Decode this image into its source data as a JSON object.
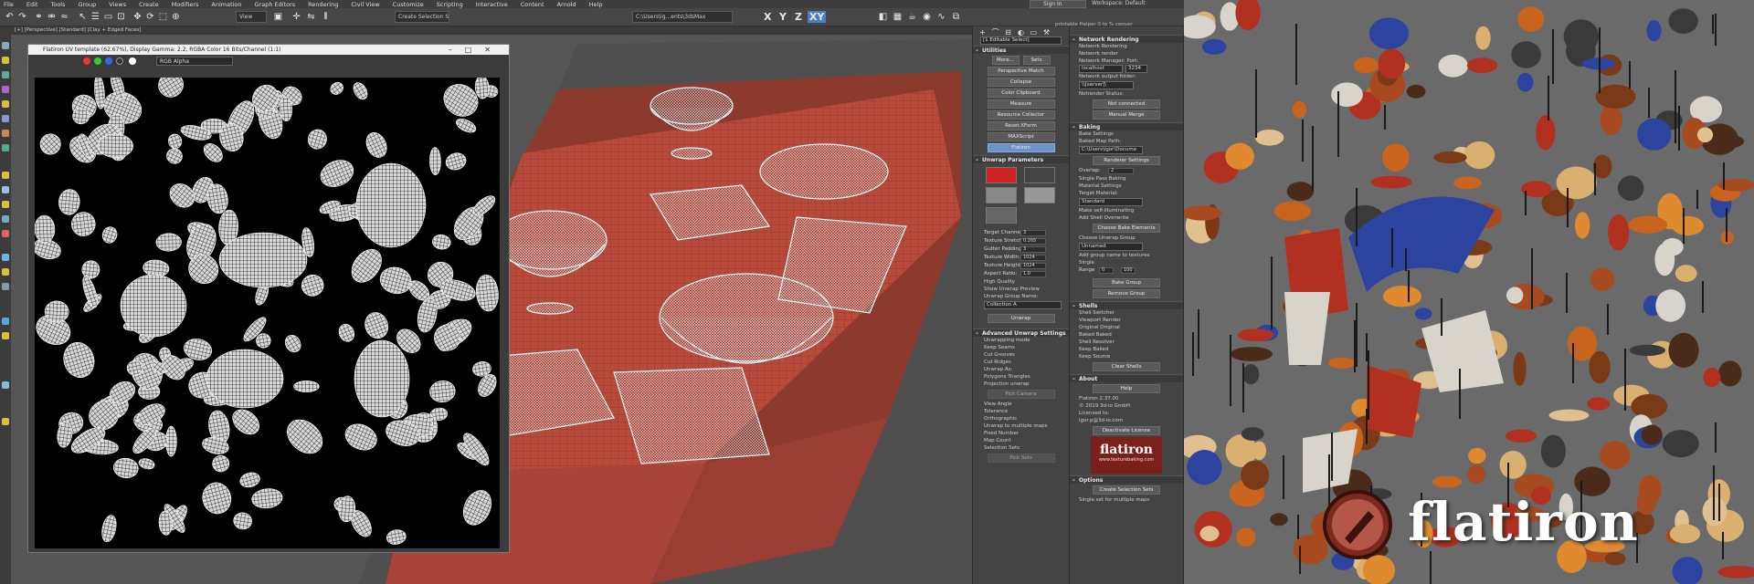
{
  "menu": [
    "File",
    "Edit",
    "Tools",
    "Group",
    "Views",
    "Create",
    "Modifiers",
    "Animation",
    "Graph Editors",
    "Rendering",
    "Civil View",
    "Customize",
    "Scripting",
    "Interactive",
    "Content",
    "Arnold",
    "Help"
  ],
  "signin": "Sign In",
  "workspace": "Workspace: Default",
  "toolbar": {
    "view_combo": "View",
    "selection_set": "Create Selection Se",
    "path_combo": "C:\\Users\\ig...ents\\3dsMax",
    "axes": [
      "X",
      "Y",
      "Z",
      "XY"
    ],
    "selected_axis": "XY",
    "hint": "printable Helper 0 to % conver"
  },
  "viewport_label": "[+] [Perspective] [Standard] [Clay + Edged Faces]",
  "uv_window": {
    "title": "Flatiron UV template (62.67%), Display Gamma: 2.2, RGBA Color 16 Bits/Channel (1:1)",
    "channel": "RGB Alpha"
  },
  "cmd_panel": {
    "selection": "[1 Editable Select]",
    "utilities_title": "Utilities",
    "utilities_top": [
      "More...",
      "Sets"
    ],
    "utilities_buttons": [
      "Perspective Match",
      "Collapse",
      "Color Clipboard",
      "Measure",
      "Resource Collector",
      "Reset XForm",
      "MAXScript",
      "Flatiron"
    ],
    "active_utility": "Flatiron",
    "unwrap_title": "Unwrap Parameters",
    "params": [
      {
        "label": "Target Channel:",
        "value": "3"
      },
      {
        "label": "Texture Stretch:",
        "value": "0.265"
      },
      {
        "label": "Gutter Padding:",
        "value": "3"
      },
      {
        "label": "Texture Width:",
        "value": "1024"
      },
      {
        "label": "Texture Height:",
        "value": "1024"
      },
      {
        "label": "Aspect Ratio:",
        "value": "1.0"
      }
    ],
    "checks": [
      "High Quality",
      "Show Unwrap Preview"
    ],
    "group_name_label": "Unwrap Group Name:",
    "group_name_value": "Collection A",
    "unwrap_btn": "Unwrap",
    "adv_title": "Advanced Unwrap Settings",
    "adv_lines": [
      "Unwrapping mode",
      "Keep Seams",
      "Cut Grooves",
      "Cut Ridges",
      "Unwrap As:",
      "Polygons  Triangles",
      "Projection unwrap",
      "Pick Camera",
      "View Angle",
      "Tolerance",
      "Orthographic",
      "Unwrap to multiple maps",
      "Fixed Number",
      "Map Count",
      "Selection Sets",
      "Pick Sets"
    ]
  },
  "right_panel": {
    "net_title": "Network Rendering",
    "net_lines": [
      "Network Rendering",
      "Network render",
      "Network Manager:  Port:"
    ],
    "host": "localhost",
    "port": "3234",
    "output_label": "Network output folder:",
    "output_value": "\\\\[server]\\",
    "status_label": "Netrender Status:",
    "status": "Not connected",
    "merge_btn": "Manual Merge",
    "baking_title": "Baking",
    "bake_settings": "Bake Settings",
    "map_path_label": "Baked Map Path:",
    "map_path": "C:\\Users\\igor\\Docume",
    "renderer_btn": "Renderer Settings",
    "overlap_label": "Overlap:",
    "overlap": "2",
    "single_pass": "Single Pass Baking",
    "mat_settings": "Material Settings",
    "target_mat_label": "Target Material:",
    "target_mat": "Standard",
    "self_illum": "Make self-illuminating",
    "shell_opts": "Add Shell   Overwrite",
    "choose_btn": "Choose Bake Elements",
    "choose_group_label": "Choose Unwrap Group",
    "choose_group": "Unnamed",
    "add_group": "Add group name to textures",
    "single": "Single",
    "range_label": "Range",
    "range_from": "0",
    "range_to": "100",
    "bake_group_btn": "Bake Group",
    "remove_group_btn": "Remove Group",
    "shells_title": "Shells",
    "shell_lines": [
      "Shell Switcher",
      "Viewport      Render",
      "Original      Original",
      "Baked         Baked",
      "Shell Resolver",
      "Keep Baked",
      "Keep Source"
    ],
    "clear_shells": "Clear Shells",
    "about_title": "About",
    "help_btn": "Help",
    "about_lines": [
      "Flatiron 2.37.00",
      "© 2019 3d-io GmbH",
      "Licensed to:",
      "igor.p@3d-io.com"
    ],
    "deactivate_btn": "Deactivate License",
    "logo_small": "flatiron",
    "logo_url": "www.texturebaking.com",
    "options_title": "Options",
    "create_sel_btn": "Create Selection Sets",
    "single_set": "Single set for multiple maps"
  },
  "brand": "flatiron",
  "colors": {
    "accent": "#6c91c8",
    "table": "#b84a3c",
    "wire": "#e8faff"
  }
}
